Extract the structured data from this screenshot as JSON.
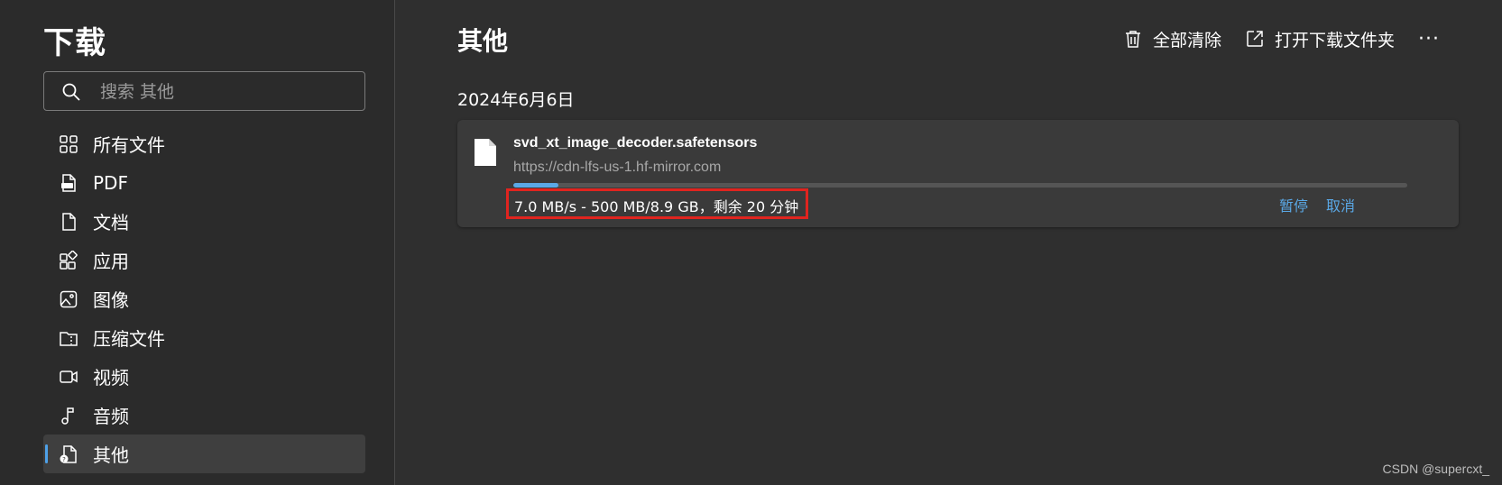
{
  "sidebar": {
    "title": "下载",
    "search": {
      "placeholder": "搜索 其他",
      "value": ""
    },
    "items": [
      {
        "label": "所有文件",
        "icon": "grid-icon"
      },
      {
        "label": "PDF",
        "icon": "pdf-icon"
      },
      {
        "label": "文档",
        "icon": "document-icon"
      },
      {
        "label": "应用",
        "icon": "apps-icon"
      },
      {
        "label": "图像",
        "icon": "image-icon"
      },
      {
        "label": "压缩文件",
        "icon": "zip-icon"
      },
      {
        "label": "视频",
        "icon": "video-icon"
      },
      {
        "label": "音频",
        "icon": "music-icon"
      },
      {
        "label": "其他",
        "icon": "other-file-icon",
        "active": true
      }
    ]
  },
  "main": {
    "title": "其他",
    "toolbar": {
      "clear_all": "全部清除",
      "open_folder": "打开下载文件夹",
      "more": "···"
    },
    "date_heading": "2024年6月6日",
    "downloads": [
      {
        "filename": "svd_xt_image_decoder.safetensors",
        "source": "https://cdn-lfs-us-1.hf-mirror.com",
        "progress": 0.05,
        "status": "7.0 MB/s - 500 MB/8.9 GB，剩余 20 分钟",
        "pause_label": "暂停",
        "cancel_label": "取消"
      }
    ]
  },
  "watermark": "CSDN @supercxt_",
  "colors": {
    "accent": "#5aa8e6",
    "highlight": "#e0241f",
    "background": "#2f2f2f",
    "sidebar_background": "#2b2b2b",
    "card_background": "#3a3a3a"
  }
}
